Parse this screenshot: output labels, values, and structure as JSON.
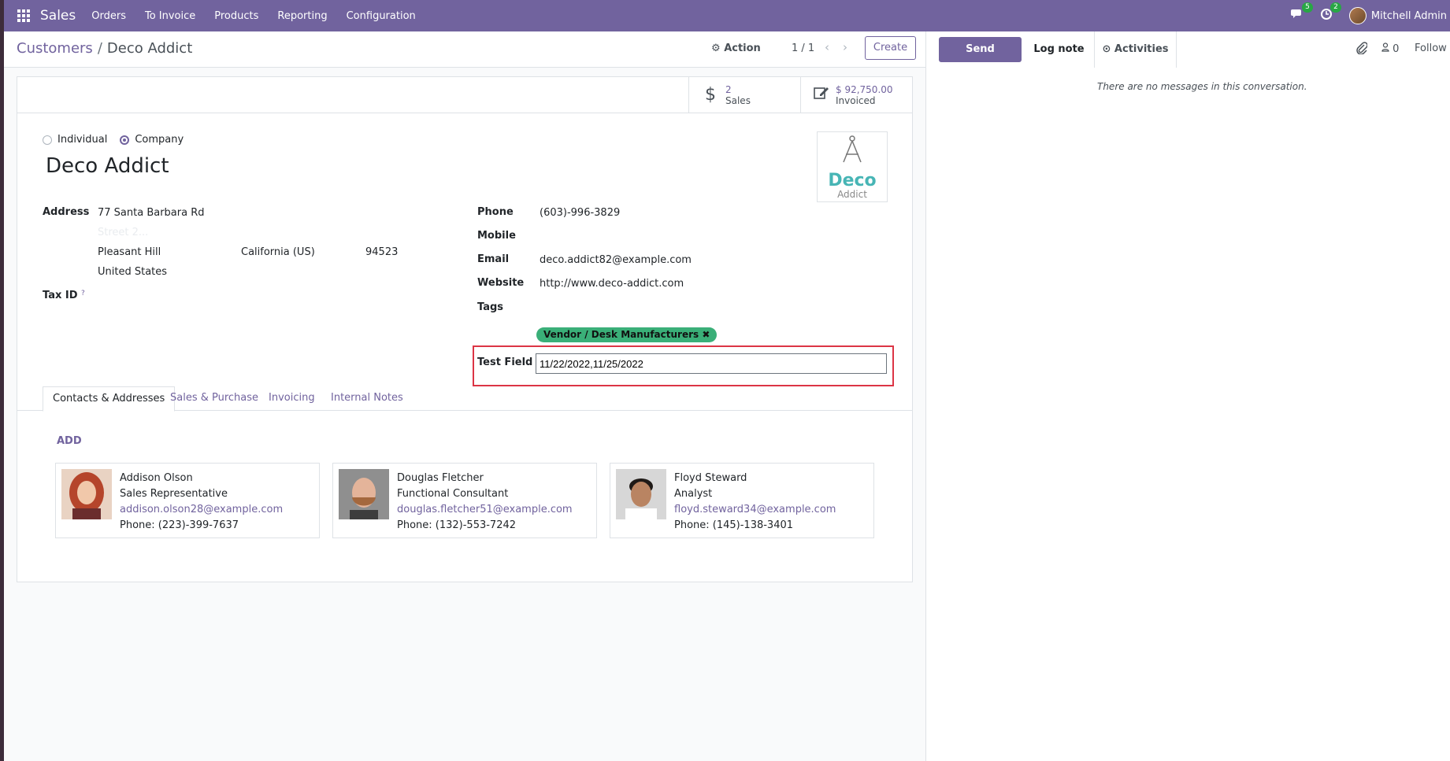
{
  "topbar": {
    "app_name": "Sales",
    "menu": [
      "Orders",
      "To Invoice",
      "Products",
      "Reporting",
      "Configuration"
    ],
    "messages_count": "5",
    "activities_count": "2",
    "user_name": "Mitchell Admin"
  },
  "control_panel": {
    "breadcrumb_parent": "Customers",
    "breadcrumb_sep": "/",
    "breadcrumb_current": "Deco Addict",
    "action_label": "Action",
    "pager": "1 / 1",
    "create_label": "Create"
  },
  "stat_buttons": {
    "sales_value": "2",
    "sales_label": "Sales",
    "invoiced_value": "$ 92,750.00",
    "invoiced_label": "Invoiced"
  },
  "form": {
    "type_individual": "Individual",
    "type_company": "Company",
    "name": "Deco Addict",
    "logo_text_main": "Deco",
    "logo_text_sub": "Addict",
    "address_label": "Address",
    "street": "77 Santa Barbara Rd",
    "street2_placeholder": "Street 2...",
    "city": "Pleasant Hill",
    "state": "California (US)",
    "zip": "94523",
    "country": "United States",
    "tax_id_label": "Tax ID",
    "tax_help": "?",
    "phone_label": "Phone",
    "phone": "(603)-996-3829",
    "mobile_label": "Mobile",
    "email_label": "Email",
    "email": "deco.addict82@example.com",
    "website_label": "Website",
    "website": "http://www.deco-addict.com",
    "tags_label": "Tags",
    "tag": "Vendor / Desk Manufacturers",
    "test_field_label": "Test Field",
    "test_field_value": "11/22/2022,11/25/2022"
  },
  "tabs": [
    "Contacts & Addresses",
    "Sales & Purchase",
    "Invoicing",
    "Internal Notes"
  ],
  "contacts": {
    "add_label": "ADD",
    "items": [
      {
        "name": "Addison Olson",
        "function": "Sales Representative",
        "email": "addison.olson28@example.com",
        "phone": "Phone: (223)-399-7637"
      },
      {
        "name": "Douglas Fletcher",
        "function": "Functional Consultant",
        "email": "douglas.fletcher51@example.com",
        "phone": "Phone: (132)-553-7242"
      },
      {
        "name": "Floyd Steward",
        "function": "Analyst",
        "email": "floyd.steward34@example.com",
        "phone": "Phone: (145)-138-3401"
      }
    ]
  },
  "chatter": {
    "send_message": "Send message",
    "log_note": "Log note",
    "activities": "Activities",
    "followers_count": "0",
    "follow": "Follow",
    "empty_text": "There are no messages in this conversation."
  },
  "colors": {
    "brand": "#71639e",
    "tag_green": "#3aaf78",
    "highlight_red": "#dc3545"
  }
}
